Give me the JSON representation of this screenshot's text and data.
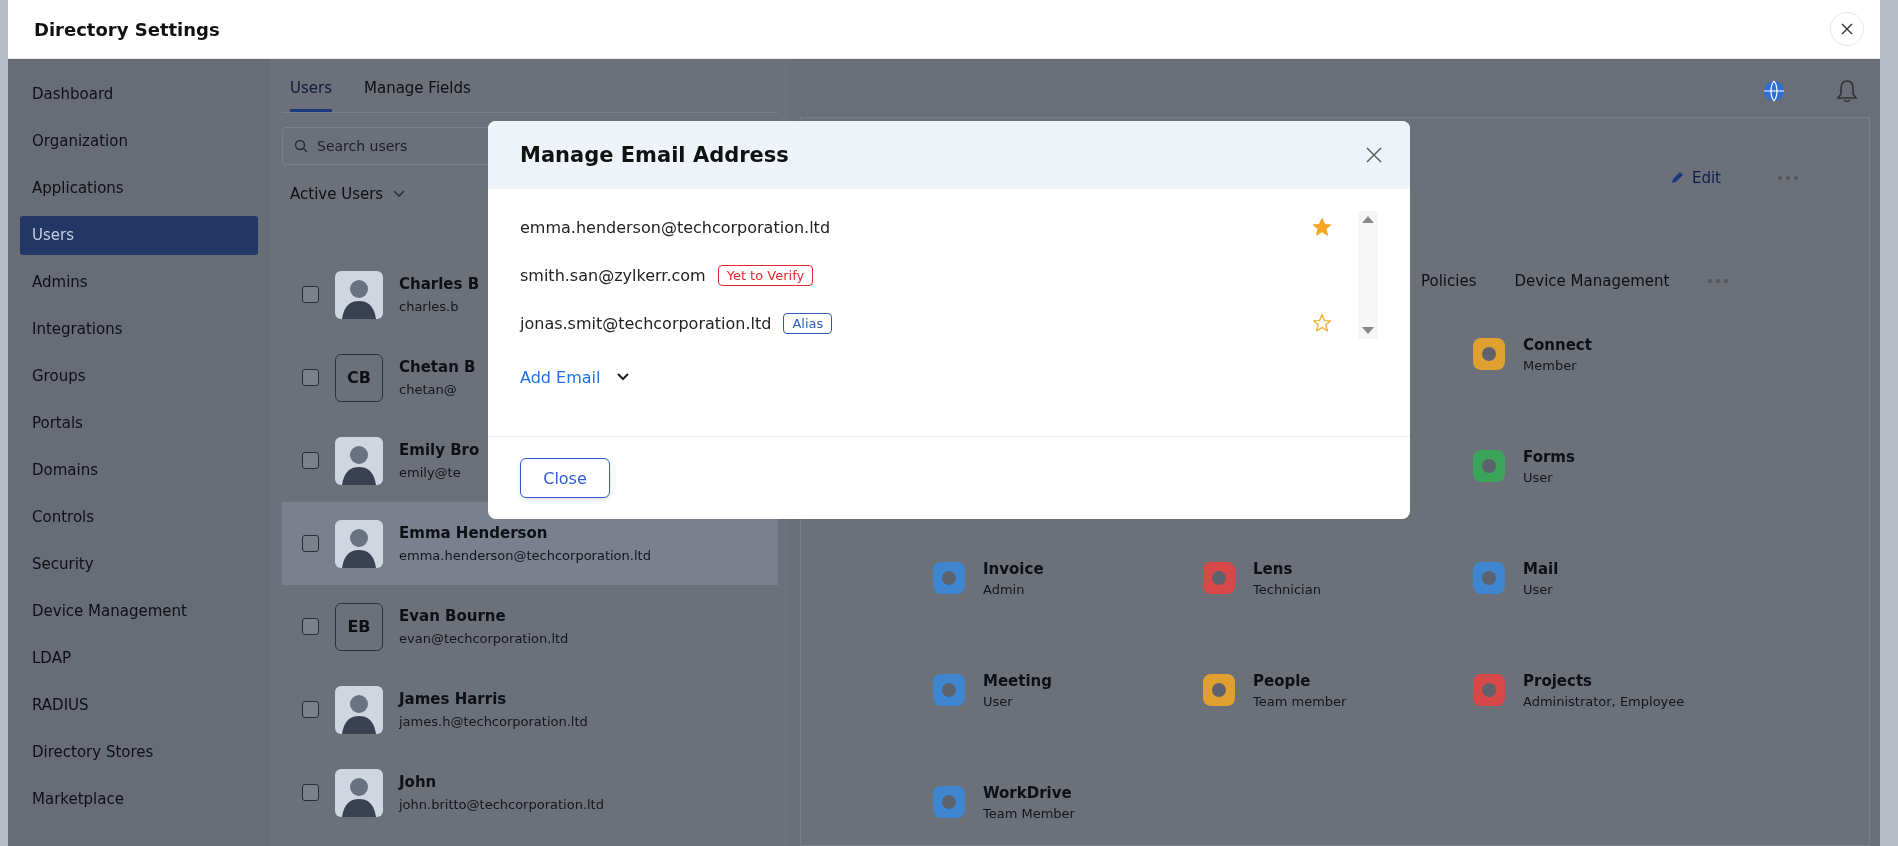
{
  "window": {
    "title": "Directory Settings"
  },
  "sidebar": {
    "items": [
      {
        "label": "Dashboard",
        "selected": false
      },
      {
        "label": "Organization",
        "selected": false
      },
      {
        "label": "Applications",
        "selected": false
      },
      {
        "label": "Users",
        "selected": true
      },
      {
        "label": "Admins",
        "selected": false
      },
      {
        "label": "Integrations",
        "selected": false
      },
      {
        "label": "Groups",
        "selected": false
      },
      {
        "label": "Portals",
        "selected": false
      },
      {
        "label": "Domains",
        "selected": false
      },
      {
        "label": "Controls",
        "selected": false
      },
      {
        "label": "Security",
        "selected": false
      },
      {
        "label": "Device Management",
        "selected": false
      },
      {
        "label": "LDAP",
        "selected": false
      },
      {
        "label": "RADIUS",
        "selected": false
      },
      {
        "label": "Directory Stores",
        "selected": false
      },
      {
        "label": "Marketplace",
        "selected": false
      }
    ]
  },
  "users_panel": {
    "tabs": [
      {
        "label": "Users",
        "selected": true
      },
      {
        "label": "Manage Fields",
        "selected": false
      }
    ],
    "search": {
      "placeholder": "Search users"
    },
    "filter": "Active Users",
    "users": [
      {
        "name": "Charles B",
        "email": "charles.b",
        "kind": "photo",
        "selected": false
      },
      {
        "name": "Chetan B",
        "email": "chetan@",
        "kind": "initials",
        "initials": "CB",
        "selected": false
      },
      {
        "name": "Emily Bro",
        "email": "emily@te",
        "kind": "photo",
        "selected": false
      },
      {
        "name": "Emma Henderson",
        "email": "emma.henderson@techcorporation.ltd",
        "kind": "photo",
        "selected": true
      },
      {
        "name": "Evan Bourne",
        "email": "evan@techcorporation.ltd",
        "kind": "initials",
        "initials": "EB",
        "selected": false
      },
      {
        "name": "James Harris",
        "email": "james.h@techcorporation.ltd",
        "kind": "photo",
        "selected": false
      },
      {
        "name": "John",
        "email": "john.britto@techcorporation.ltd",
        "kind": "photo",
        "selected": false
      }
    ]
  },
  "detail": {
    "edit": "Edit",
    "tabs": [
      "Policies",
      "Device Management"
    ],
    "apps": [
      {
        "name": "Connect",
        "role": "Member",
        "color": "#e0a030"
      },
      {
        "name": "Forms",
        "role": "User",
        "color": "#3aa55a"
      },
      {
        "name": "Invoice",
        "role": "Admin",
        "color": "#3f86d0"
      },
      {
        "name": "Lens",
        "role": "Technician",
        "color": "#d94848"
      },
      {
        "name": "Mail",
        "role": "User",
        "color": "#3f86d0"
      },
      {
        "name": "Meeting",
        "role": "User",
        "color": "#3f86d0"
      },
      {
        "name": "People",
        "role": "Team member",
        "color": "#e0a030"
      },
      {
        "name": "Projects",
        "role": "Administrator, Employee",
        "color": "#d94848"
      },
      {
        "name": "WorkDrive",
        "role": "Team Member",
        "color": "#3f86d0"
      }
    ]
  },
  "dialog": {
    "title": "Manage Email Address",
    "emails": [
      {
        "address": "emma.henderson@techcorporation.ltd",
        "star_filled": true
      },
      {
        "address": "smith.san@zylkerr.com",
        "badge": {
          "text": "Yet to Verify",
          "kind": "warning"
        }
      },
      {
        "address": "jonas.smit@techcorporation.ltd",
        "badge": {
          "text": "Alias",
          "kind": "alias"
        },
        "star_filled": false
      }
    ],
    "add_label": "Add Email",
    "close_label": "Close"
  }
}
